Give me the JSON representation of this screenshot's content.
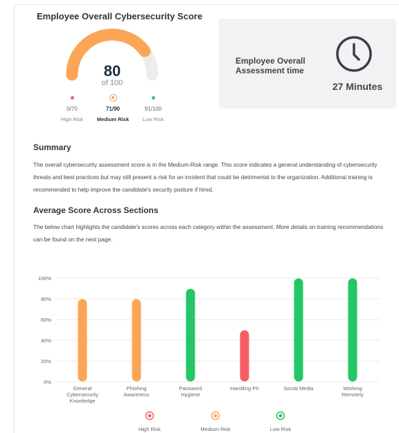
{
  "score_card": {
    "title": "Employee Overall Cybersecurity Score",
    "score": "80",
    "score_of": "of 100",
    "score_fraction": 0.8,
    "risk_levels": [
      {
        "range": "0/70",
        "label": "High Risk",
        "color": "#f0606a",
        "active": false
      },
      {
        "range": "71/90",
        "label": "Medium Risk",
        "color": "#f8a055",
        "active": true
      },
      {
        "range": "91/100",
        "label": "Low Risk",
        "color": "#2ccd6e",
        "active": false
      }
    ]
  },
  "time_card": {
    "label": "Employee Overall Assessment time",
    "value": "27 Minutes",
    "icon": "clock-icon"
  },
  "summary": {
    "heading": "Summary",
    "text": "The overall cybersecurity assessment score is in the Medium-Risk range. This score indicates a general understanding of cybersecurity threats and best practices but may still present a risk for an incident that could be detrimental to the organization. Additional training is recommended to help improve the candidate's security posture if hired."
  },
  "sections": {
    "heading": "Average Score Across Sections",
    "text": "The below chart highlights the candidate's scores across each category within the assessment. More details on training recommendations can be found on the next page."
  },
  "colors": {
    "high": "#f65e63",
    "medium": "#fba556",
    "low": "#22c766",
    "gauge_track": "#ececec"
  },
  "chart_data": {
    "type": "bar",
    "categories": [
      "General Cybersecurity Knowledge",
      "Phishing Awareness",
      "Password Hygiene",
      "Handling PII",
      "Social Media",
      "Working Remotely"
    ],
    "values": [
      80,
      80,
      90,
      50,
      100,
      100
    ],
    "bar_risk": [
      "medium",
      "medium",
      "low",
      "high",
      "low",
      "low"
    ],
    "y_ticks": [
      "0%",
      "20%",
      "40%",
      "60%",
      "80%",
      "100%"
    ],
    "ylim": [
      0,
      100
    ],
    "grid": true,
    "legend": [
      {
        "label": "High Risk",
        "risk": "high"
      },
      {
        "label": "Medium Risk",
        "risk": "medium"
      },
      {
        "label": "Low Risk",
        "risk": "low"
      }
    ],
    "legend_position": "bottom"
  }
}
